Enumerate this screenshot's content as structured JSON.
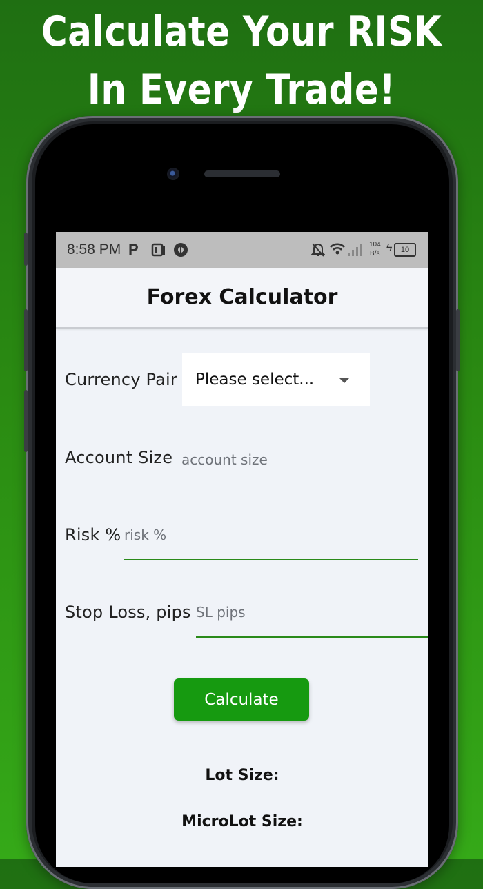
{
  "promo": {
    "line1": "Calculate Your RISK",
    "line2": "In Every Trade!"
  },
  "status_bar": {
    "time": "8:58 PM",
    "left_icons": [
      "parking-p-icon",
      "pocket-app-icon",
      "opera-icon"
    ],
    "right_icons": [
      "bell-muted-icon",
      "wifi-icon",
      "signal-icon",
      "battery-icon"
    ],
    "net_speed_value": "104",
    "net_speed_unit": "B/s",
    "battery_level": "10"
  },
  "app": {
    "title": "Forex Calculator",
    "form": {
      "currency_pair_label": "Currency Pair",
      "currency_pair_value": "Please select...",
      "account_size_label": "Account Size",
      "account_size_placeholder": "account size",
      "risk_label": "Risk %",
      "risk_placeholder": "risk %",
      "stop_loss_label": "Stop Loss, pips",
      "stop_loss_placeholder": "SL pips"
    },
    "calculate_button": "Calculate",
    "results": {
      "lot_size_label": "Lot Size:",
      "microlot_size_label": "MicroLot Size:"
    }
  },
  "colors": {
    "background_green": "#2a8a12",
    "button_green": "#169a10",
    "underline_green": "#2a8a1a"
  }
}
